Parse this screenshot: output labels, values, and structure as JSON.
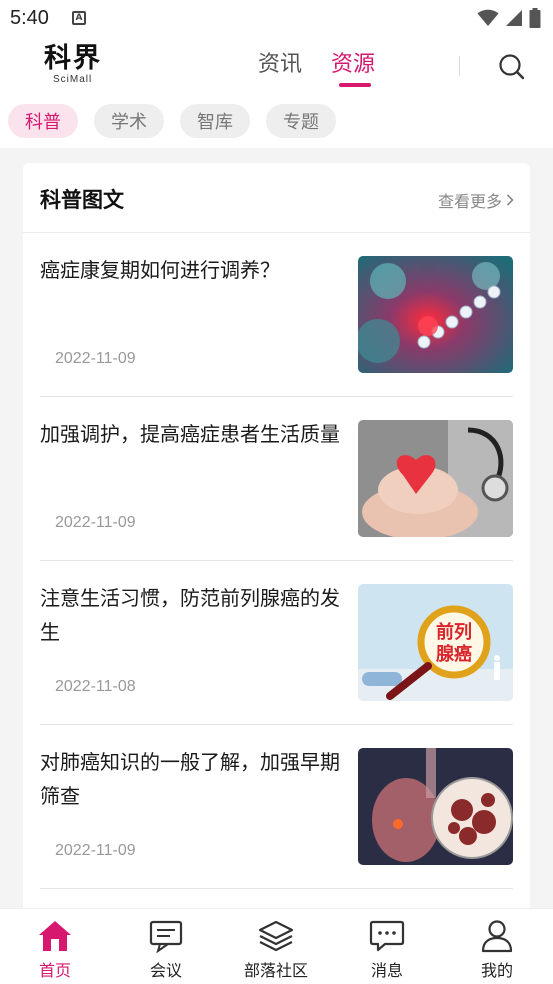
{
  "status_bar": {
    "time": "5:40",
    "notification_letter": "A"
  },
  "header": {
    "logo_main": "科界",
    "logo_sub": "SciMall",
    "tabs": [
      {
        "label": "资讯",
        "active": false
      },
      {
        "label": "资源",
        "active": true
      }
    ],
    "search_icon": "search-icon"
  },
  "chips": [
    {
      "label": "科普",
      "active": true
    },
    {
      "label": "学术",
      "active": false
    },
    {
      "label": "智库",
      "active": false
    },
    {
      "label": "专题",
      "active": false
    }
  ],
  "section": {
    "title": "科普图文",
    "more_label": "查看更多"
  },
  "articles": [
    {
      "title": "癌症康复期如何进行调养？",
      "date": "2022-11-09"
    },
    {
      "title": "加强调护，提高癌症患者生活质量",
      "date": "2022-11-09"
    },
    {
      "title": "注意生活习惯，防范前列腺癌的发生",
      "date": "2022-11-08",
      "thumb_text": "前列\n腺癌"
    },
    {
      "title": "对肺癌知识的一般了解，加强早期筛查",
      "date": "2022-11-09"
    }
  ],
  "bottom_nav": [
    {
      "label": "首页",
      "icon": "home-icon",
      "active": true
    },
    {
      "label": "会议",
      "icon": "meeting-icon",
      "active": false
    },
    {
      "label": "部落社区",
      "icon": "layers-icon",
      "active": false
    },
    {
      "label": "消息",
      "icon": "message-icon",
      "active": false
    },
    {
      "label": "我的",
      "icon": "user-icon",
      "active": false
    }
  ],
  "colors": {
    "accent": "#d6196f",
    "chip_active_bg": "#fbe3ee",
    "page_bg": "#f4f4f4"
  }
}
